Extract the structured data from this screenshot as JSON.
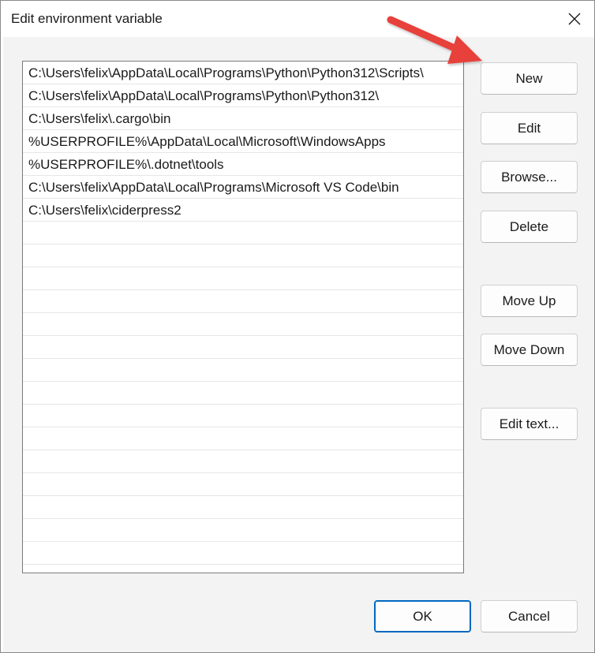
{
  "window": {
    "title": "Edit environment variable",
    "close_icon": "close-icon"
  },
  "list": {
    "items": [
      "C:\\Users\\felix\\AppData\\Local\\Programs\\Python\\Python312\\Scripts\\",
      "C:\\Users\\felix\\AppData\\Local\\Programs\\Python\\Python312\\",
      "C:\\Users\\felix\\.cargo\\bin",
      "%USERPROFILE%\\AppData\\Local\\Microsoft\\WindowsApps",
      "%USERPROFILE%\\.dotnet\\tools",
      "C:\\Users\\felix\\AppData\\Local\\Programs\\Microsoft VS Code\\bin",
      "C:\\Users\\felix\\ciderpress2"
    ]
  },
  "buttons": {
    "new": "New",
    "edit": "Edit",
    "browse": "Browse...",
    "delete": "Delete",
    "move_up": "Move Up",
    "move_down": "Move Down",
    "edit_text": "Edit text...",
    "ok": "OK",
    "cancel": "Cancel"
  },
  "annotation": {
    "arrow_color": "#e8413a",
    "arrow_icon": "red-arrow-annotation"
  },
  "colors": {
    "ok_border": "#0067c0",
    "dialog_bg": "#f3f3f3"
  }
}
